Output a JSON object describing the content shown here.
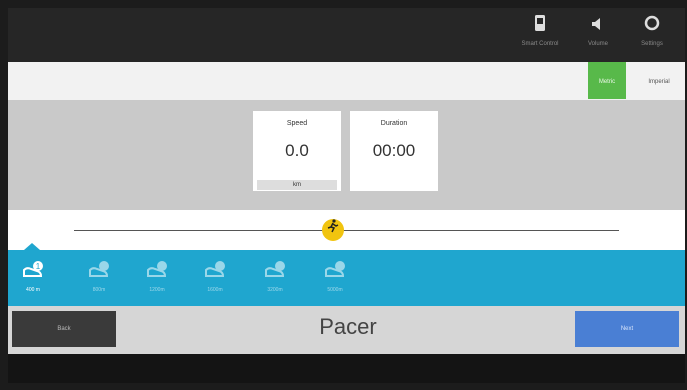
{
  "topbar": {
    "buttons": [
      {
        "icon": "phone-icon",
        "label": "Smart Control"
      },
      {
        "icon": "speaker-icon",
        "label": "Volume"
      },
      {
        "icon": "gear-icon",
        "label": "Settings"
      }
    ]
  },
  "units": {
    "metric": "Metric",
    "imperial": "Imperial",
    "active": "metric",
    "active_color": "#58b94a"
  },
  "tiles": {
    "speed": {
      "title": "Speed",
      "value": "0.0",
      "unit": "km"
    },
    "duration": {
      "title": "Duration",
      "value": "00:00"
    }
  },
  "slider": {
    "icon": "runner-icon",
    "knob_color": "#f1c40f"
  },
  "workouts": [
    {
      "label": "400 m",
      "badge": "1",
      "active": true
    },
    {
      "label": "800m",
      "active": false
    },
    {
      "label": "1200m",
      "active": false
    },
    {
      "label": "1600m",
      "active": false
    },
    {
      "label": "3200m",
      "active": false
    },
    {
      "label": "5000m",
      "active": false
    }
  ],
  "bottombar": {
    "back_label": "Back",
    "title": "Pacer",
    "next_label": "Next",
    "next_color": "#4a7fd4"
  },
  "colors": {
    "strip": "#1fa6cf",
    "topbar": "#262626"
  }
}
